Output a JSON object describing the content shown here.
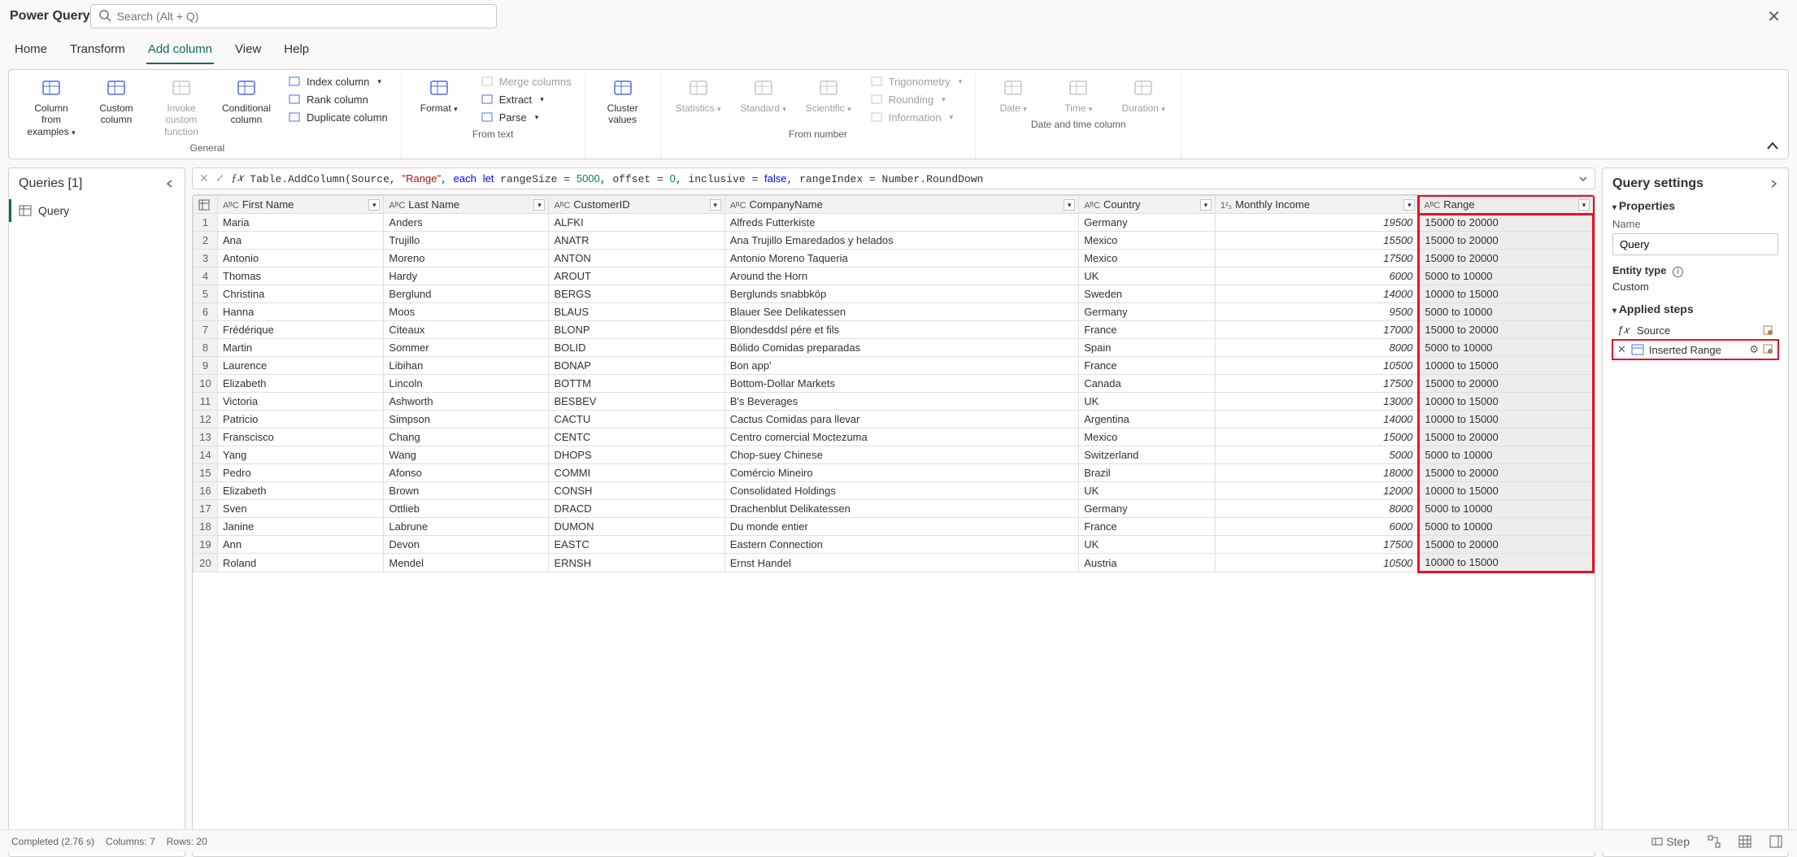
{
  "app": {
    "title": "Power Query",
    "search_placeholder": "Search (Alt + Q)"
  },
  "menu": {
    "tabs": [
      "Home",
      "Transform",
      "Add column",
      "View",
      "Help"
    ],
    "active": 2
  },
  "ribbon": {
    "groups": [
      {
        "label": "General",
        "big": [
          {
            "label": "Column from examples",
            "sub": "",
            "dd": true
          },
          {
            "label": "Custom column"
          },
          {
            "label": "Invoke custom function",
            "disabled": true
          },
          {
            "label": "Conditional column"
          }
        ],
        "small": [
          {
            "label": "Index column",
            "dd": true
          },
          {
            "label": "Rank column"
          },
          {
            "label": "Duplicate column"
          }
        ]
      },
      {
        "label": "From text",
        "big": [
          {
            "label": "Format",
            "dd": true
          }
        ],
        "small": [
          {
            "label": "Merge columns",
            "disabled": true
          },
          {
            "label": "Extract",
            "dd": true
          },
          {
            "label": "Parse",
            "dd": true
          }
        ]
      },
      {
        "label": "",
        "big": [
          {
            "label": "Cluster values"
          }
        ]
      },
      {
        "label": "From number",
        "big": [
          {
            "label": "Statistics",
            "disabled": true,
            "dd": true
          },
          {
            "label": "Standard",
            "disabled": true,
            "dd": true
          },
          {
            "label": "Scientific",
            "disabled": true,
            "dd": true
          }
        ],
        "small": [
          {
            "label": "Trigonometry",
            "disabled": true,
            "dd": true
          },
          {
            "label": "Rounding",
            "disabled": true,
            "dd": true
          },
          {
            "label": "Information",
            "disabled": true,
            "dd": true
          }
        ]
      },
      {
        "label": "Date and time column",
        "big": [
          {
            "label": "Date",
            "disabled": true,
            "dd": true
          },
          {
            "label": "Time",
            "disabled": true,
            "dd": true
          },
          {
            "label": "Duration",
            "disabled": true,
            "dd": true
          }
        ]
      }
    ]
  },
  "queries": {
    "title": "Queries [1]",
    "items": [
      "Query"
    ],
    "active": 0
  },
  "formula": {
    "raw": "Table.AddColumn(Source, \"Range\", each let rangeSize = 5000, offset = 0, inclusive = false, rangeIndex = Number.RoundDown"
  },
  "grid": {
    "columns": [
      {
        "name": "First Name",
        "type": "text"
      },
      {
        "name": "Last Name",
        "type": "text"
      },
      {
        "name": "CustomerID",
        "type": "text"
      },
      {
        "name": "CompanyName",
        "type": "text"
      },
      {
        "name": "Country",
        "type": "text"
      },
      {
        "name": "Monthly Income",
        "type": "number"
      },
      {
        "name": "Range",
        "type": "text",
        "selected": true,
        "highlight": true
      }
    ],
    "rows": [
      [
        "Maria",
        "Anders",
        "ALFKI",
        "Alfreds Futterkiste",
        "Germany",
        "19500",
        "15000 to 20000"
      ],
      [
        "Ana",
        "Trujillo",
        "ANATR",
        "Ana Trujillo Emaredados y helados",
        "Mexico",
        "15500",
        "15000 to 20000"
      ],
      [
        "Antonio",
        "Moreno",
        "ANTON",
        "Antonio Moreno Taqueria",
        "Mexico",
        "17500",
        "15000 to 20000"
      ],
      [
        "Thomas",
        "Hardy",
        "AROUT",
        "Around the Horn",
        "UK",
        "6000",
        "5000 to 10000"
      ],
      [
        "Christina",
        "Berglund",
        "BERGS",
        "Berglunds snabbköp",
        "Sweden",
        "14000",
        "10000 to 15000"
      ],
      [
        "Hanna",
        "Moos",
        "BLAUS",
        "Blauer See Delikatessen",
        "Germany",
        "9500",
        "5000 to 10000"
      ],
      [
        "Frédérique",
        "Citeaux",
        "BLONP",
        "Blondesddsl pére et fils",
        "France",
        "17000",
        "15000 to 20000"
      ],
      [
        "Martin",
        "Sommer",
        "BOLID",
        "Bólido Comidas preparadas",
        "Spain",
        "8000",
        "5000 to 10000"
      ],
      [
        "Laurence",
        "Libihan",
        "BONAP",
        "Bon app'",
        "France",
        "10500",
        "10000 to 15000"
      ],
      [
        "Elizabeth",
        "Lincoln",
        "BOTTM",
        "Bottom-Dollar Markets",
        "Canada",
        "17500",
        "15000 to 20000"
      ],
      [
        "Victoria",
        "Ashworth",
        "BESBEV",
        "B's Beverages",
        "UK",
        "13000",
        "10000 to 15000"
      ],
      [
        "Patricio",
        "Simpson",
        "CACTU",
        "Cactus Comidas para llevar",
        "Argentina",
        "14000",
        "10000 to 15000"
      ],
      [
        "Franscisco",
        "Chang",
        "CENTC",
        "Centro comercial Moctezuma",
        "Mexico",
        "15000",
        "15000 to 20000"
      ],
      [
        "Yang",
        "Wang",
        "DHOPS",
        "Chop-suey Chinese",
        "Switzerland",
        "5000",
        "5000 to 10000"
      ],
      [
        "Pedro",
        "Afonso",
        "COMMI",
        "Comércio Mineiro",
        "Brazil",
        "18000",
        "15000 to 20000"
      ],
      [
        "Elizabeth",
        "Brown",
        "CONSH",
        "Consolidated Holdings",
        "UK",
        "12000",
        "10000 to 15000"
      ],
      [
        "Sven",
        "Ottlieb",
        "DRACD",
        "Drachenblut Delikatessen",
        "Germany",
        "8000",
        "5000 to 10000"
      ],
      [
        "Janine",
        "Labrune",
        "DUMON",
        "Du monde entier",
        "France",
        "6000",
        "5000 to 10000"
      ],
      [
        "Ann",
        "Devon",
        "EASTC",
        "Eastern Connection",
        "UK",
        "17500",
        "15000 to 20000"
      ],
      [
        "Roland",
        "Mendel",
        "ERNSH",
        "Ernst Handel",
        "Austria",
        "10500",
        "10000 to 15000"
      ]
    ]
  },
  "settings": {
    "title": "Query settings",
    "properties_label": "Properties",
    "name_label": "Name",
    "name_value": "Query",
    "entity_label": "Entity type",
    "entity_value": "Custom",
    "steps_label": "Applied steps",
    "steps": [
      {
        "label": "Source",
        "fx": true
      },
      {
        "label": "Inserted Range",
        "active": true,
        "gear": true
      }
    ]
  },
  "status": {
    "completed": "Completed (2.76 s)",
    "columns": "Columns: 7",
    "rows": "Rows: 20",
    "step_label": "Step"
  }
}
